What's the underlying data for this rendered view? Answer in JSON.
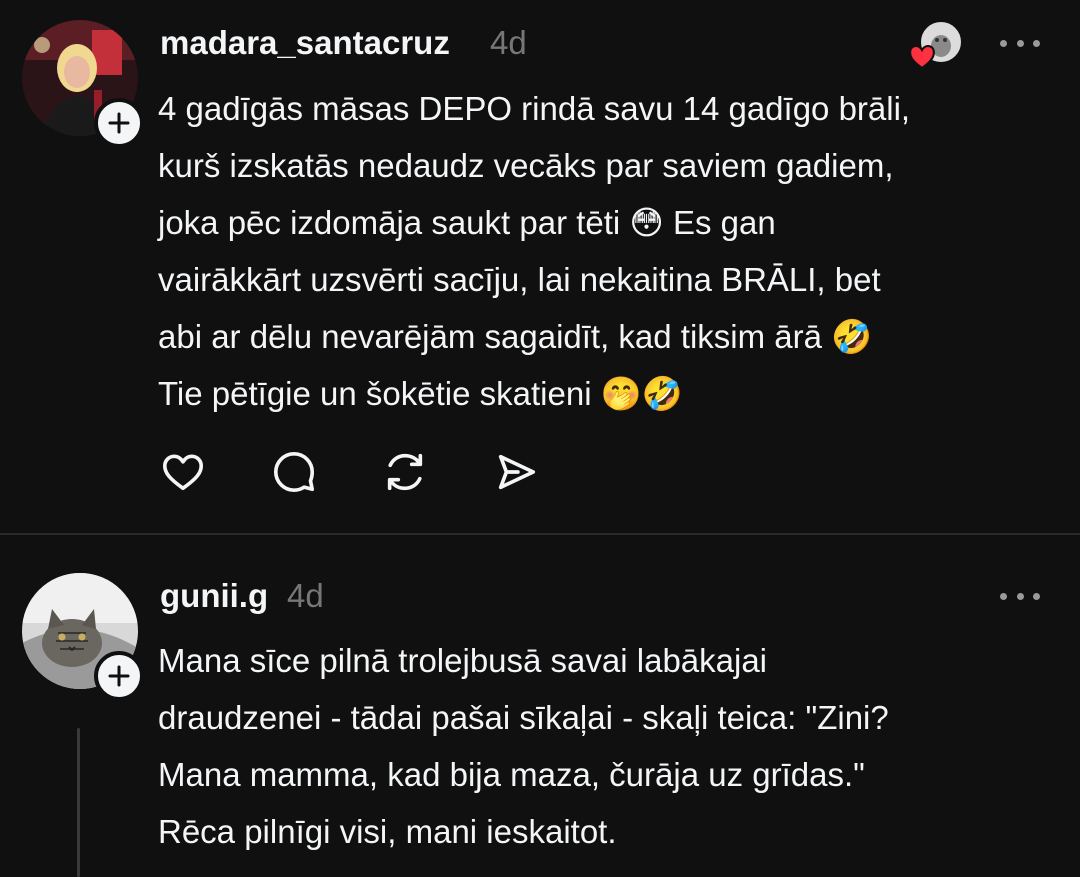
{
  "posts": [
    {
      "username": "madara_santacruz",
      "time": "4d",
      "avatar_icon": "profile-photo-woman",
      "lines": [
        "4 gadīgās māsas DEPO rindā savu 14 gadīgo brāli,",
        "kurš izskatās nedaudz vecāks par saviem gadiem,",
        "joka pēc izdomāja saukt par tēti 😳 Es gan",
        "vairākkārt uzsvērti sacīju, lai nekaitina BRĀLI, bet",
        "abi ar dēlu nevarējām sagaidīt, kad tiksim ārā 🤣",
        "Tie pētīgie un šokētie skatieni 🤭🤣"
      ],
      "actions": [
        "heart-icon",
        "comment-icon",
        "repost-icon",
        "share-icon"
      ]
    },
    {
      "username": "gunii.g",
      "time": "4d",
      "avatar_icon": "profile-photo-cat",
      "lines": [
        "Mana sīce pilnā trolejbusā savai labākajai",
        "draudzenei - tādai pašai sīkaļai - skaļi teica: \"Zini?",
        "Mana mamma, kad bija maza, čurāja uz grīdas.\"",
        "Rēca pilnīgi visi, mani ieskaitot."
      ]
    }
  ],
  "colors": {
    "background": "#101010",
    "text": "#f3f5f7",
    "muted": "#777777",
    "like": "#ff3040"
  }
}
